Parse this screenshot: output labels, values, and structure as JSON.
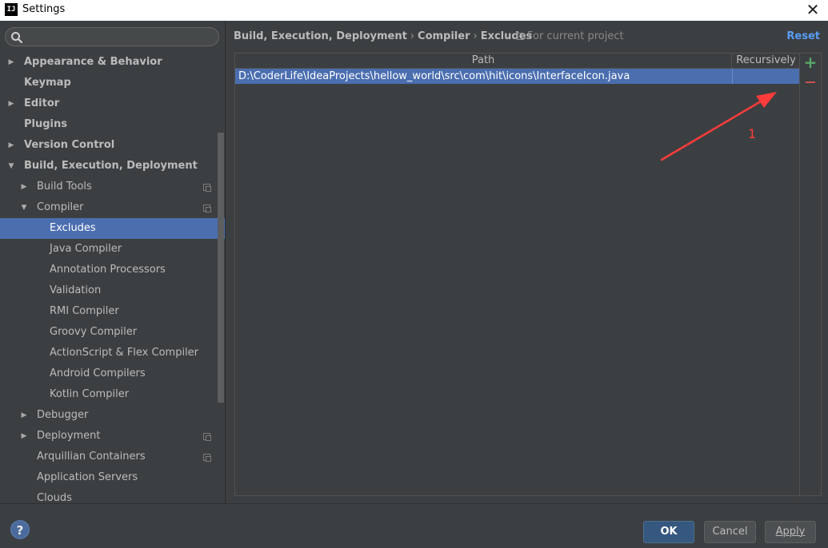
{
  "window": {
    "title": "Settings",
    "app_icon": "IJ",
    "close_glyph": "✕"
  },
  "search": {
    "placeholder": "",
    "value": ""
  },
  "tree": [
    {
      "label": "Appearance & Behavior",
      "level": 0,
      "bold": true,
      "arrow": "right",
      "project": false,
      "selected": false
    },
    {
      "label": "Keymap",
      "level": 0,
      "bold": true,
      "arrow": "none",
      "project": false,
      "selected": false
    },
    {
      "label": "Editor",
      "level": 0,
      "bold": true,
      "arrow": "right",
      "project": false,
      "selected": false
    },
    {
      "label": "Plugins",
      "level": 0,
      "bold": true,
      "arrow": "none",
      "project": false,
      "selected": false
    },
    {
      "label": "Version Control",
      "level": 0,
      "bold": true,
      "arrow": "right",
      "project": false,
      "selected": false
    },
    {
      "label": "Build, Execution, Deployment",
      "level": 0,
      "bold": true,
      "arrow": "down",
      "project": false,
      "selected": false
    },
    {
      "label": "Build Tools",
      "level": 1,
      "bold": false,
      "arrow": "right",
      "project": true,
      "selected": false
    },
    {
      "label": "Compiler",
      "level": 1,
      "bold": false,
      "arrow": "down",
      "project": true,
      "selected": false
    },
    {
      "label": "Excludes",
      "level": 2,
      "bold": false,
      "arrow": "none",
      "project": false,
      "selected": true
    },
    {
      "label": "Java Compiler",
      "level": 2,
      "bold": false,
      "arrow": "none",
      "project": false,
      "selected": false
    },
    {
      "label": "Annotation Processors",
      "level": 2,
      "bold": false,
      "arrow": "none",
      "project": false,
      "selected": false
    },
    {
      "label": "Validation",
      "level": 2,
      "bold": false,
      "arrow": "none",
      "project": false,
      "selected": false
    },
    {
      "label": "RMI Compiler",
      "level": 2,
      "bold": false,
      "arrow": "none",
      "project": false,
      "selected": false
    },
    {
      "label": "Groovy Compiler",
      "level": 2,
      "bold": false,
      "arrow": "none",
      "project": false,
      "selected": false
    },
    {
      "label": "ActionScript & Flex Compiler",
      "level": 2,
      "bold": false,
      "arrow": "none",
      "project": false,
      "selected": false
    },
    {
      "label": "Android Compilers",
      "level": 2,
      "bold": false,
      "arrow": "none",
      "project": false,
      "selected": false
    },
    {
      "label": "Kotlin Compiler",
      "level": 2,
      "bold": false,
      "arrow": "none",
      "project": false,
      "selected": false
    },
    {
      "label": "Debugger",
      "level": 1,
      "bold": false,
      "arrow": "right",
      "project": false,
      "selected": false
    },
    {
      "label": "Deployment",
      "level": 1,
      "bold": false,
      "arrow": "right",
      "project": true,
      "selected": false
    },
    {
      "label": "Arquillian Containers",
      "level": 1,
      "bold": false,
      "arrow": "none",
      "project": true,
      "selected": false
    },
    {
      "label": "Application Servers",
      "level": 1,
      "bold": false,
      "arrow": "none",
      "project": false,
      "selected": false
    },
    {
      "label": "Clouds",
      "level": 1,
      "bold": false,
      "arrow": "none",
      "project": false,
      "selected": false
    }
  ],
  "header": {
    "breadcrumb": [
      "Build, Execution, Deployment",
      "Compiler",
      "Excludes"
    ],
    "breadcrumb_separator": "›",
    "scope": "For current project",
    "reset": "Reset"
  },
  "excludes_table": {
    "columns": [
      "Path",
      "Recursively"
    ],
    "rows": [
      {
        "path": "D:\\CoderLife\\IdeaProjects\\hellow_world\\src\\com\\hit\\icons\\InterfaceIcon.java",
        "recursively": "",
        "selected": true
      }
    ],
    "add_glyph": "+",
    "remove_glyph": "−"
  },
  "annotation": {
    "label": "1",
    "color": "#ff3b3b"
  },
  "footer": {
    "help": "?",
    "ok": "OK",
    "cancel": "Cancel",
    "apply": "Apply"
  },
  "colors": {
    "background": "#3c3f41",
    "selection": "#4b6eaf",
    "link": "#589df6",
    "add": "#59a869",
    "remove": "#c75450",
    "ok_button": "#365880"
  }
}
